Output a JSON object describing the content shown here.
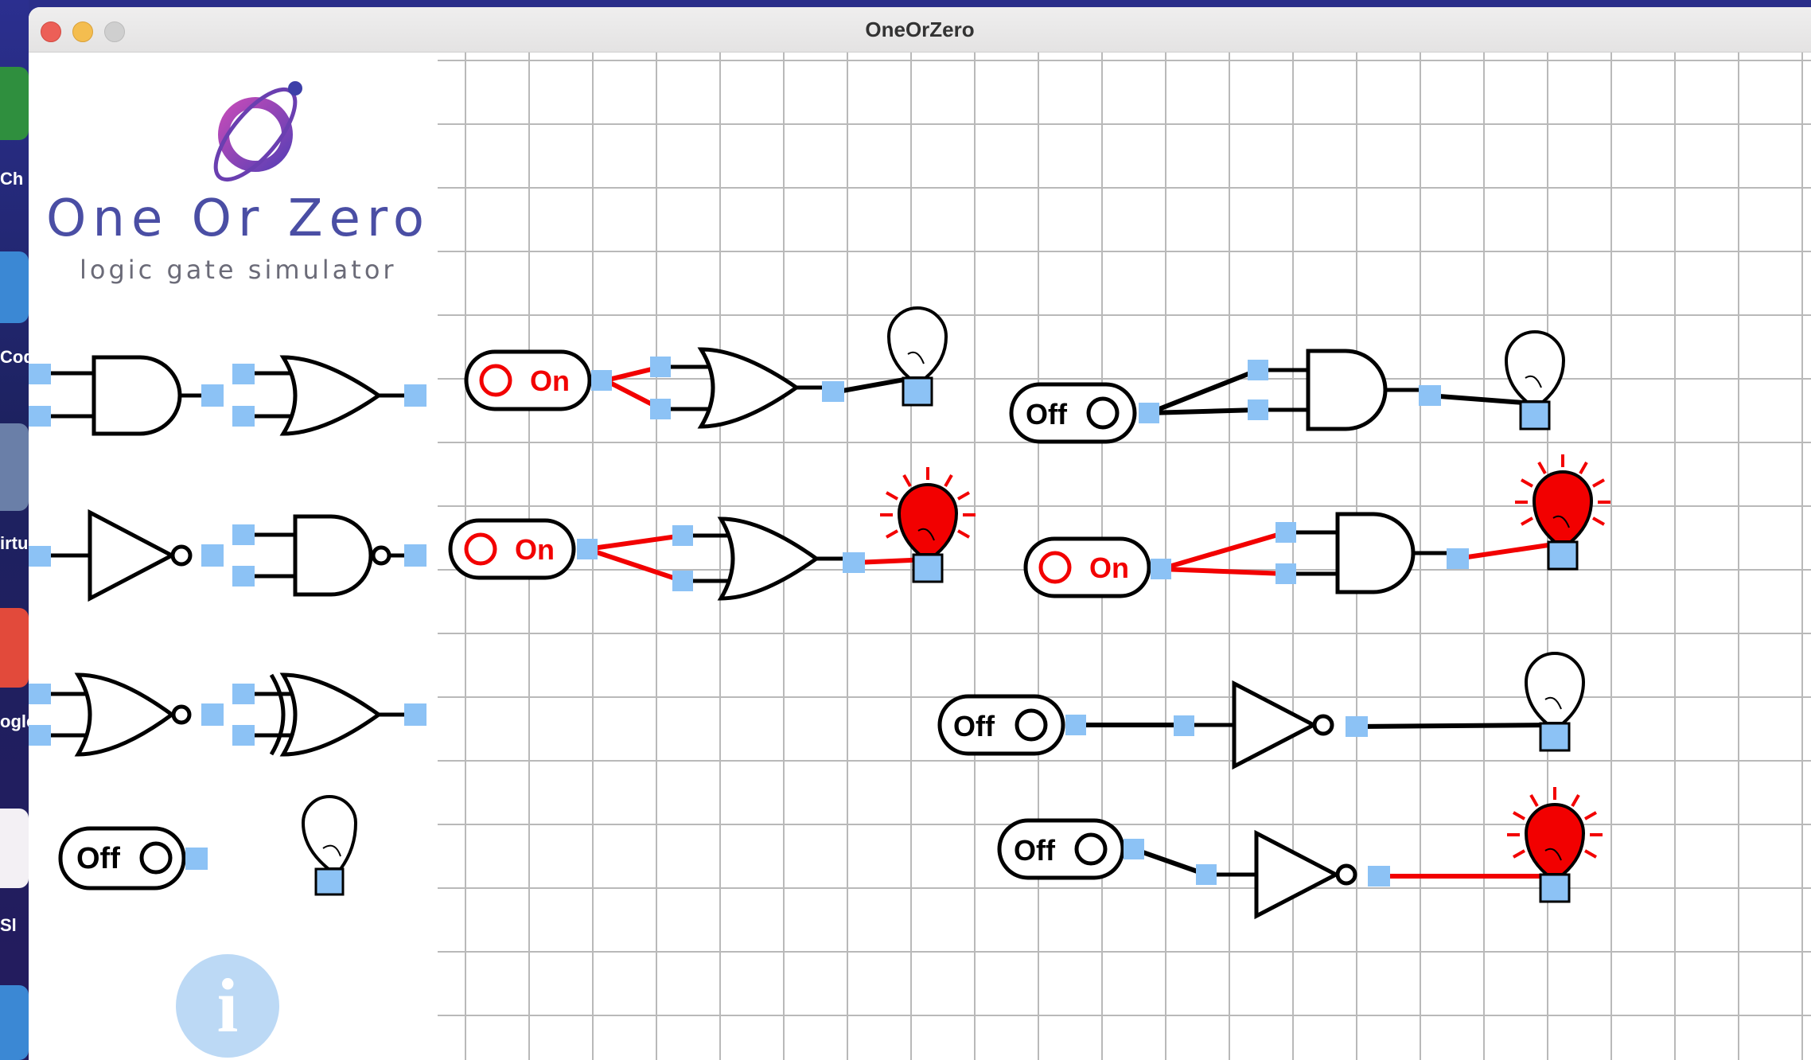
{
  "window": {
    "title": "OneOrZero"
  },
  "desktop": {
    "dock_labels": [
      "Ch",
      "Cod",
      "irtu",
      "ogle",
      "Sl"
    ]
  },
  "palette": {
    "logo_title": "One Or Zero",
    "logo_subtitle": "logic gate simulator",
    "items": [
      "and-gate",
      "or-gate",
      "not-gate",
      "nand-gate",
      "nor-gate",
      "xor-gate",
      "switch",
      "light-bulb"
    ],
    "switch_label": "Off",
    "info_button": "i"
  },
  "canvas": {
    "switch_on_label": "On",
    "switch_off_label": "Off",
    "circuits": [
      {
        "gate": "or",
        "input": "On",
        "output": "off"
      },
      {
        "gate": "and",
        "input": "Off",
        "output": "off"
      },
      {
        "gate": "or",
        "input": "On",
        "output": "on"
      },
      {
        "gate": "and",
        "input": "On",
        "output": "on"
      },
      {
        "gate": "not",
        "input": "Off",
        "output": "off"
      },
      {
        "gate": "not",
        "input": "Off",
        "output": "on"
      }
    ]
  },
  "colors": {
    "pin": "#8cc2f5",
    "wire_active": "#f20000",
    "wire_inactive": "#000000",
    "bulb_on": "#f20000",
    "logo": "#4a4ea4"
  }
}
